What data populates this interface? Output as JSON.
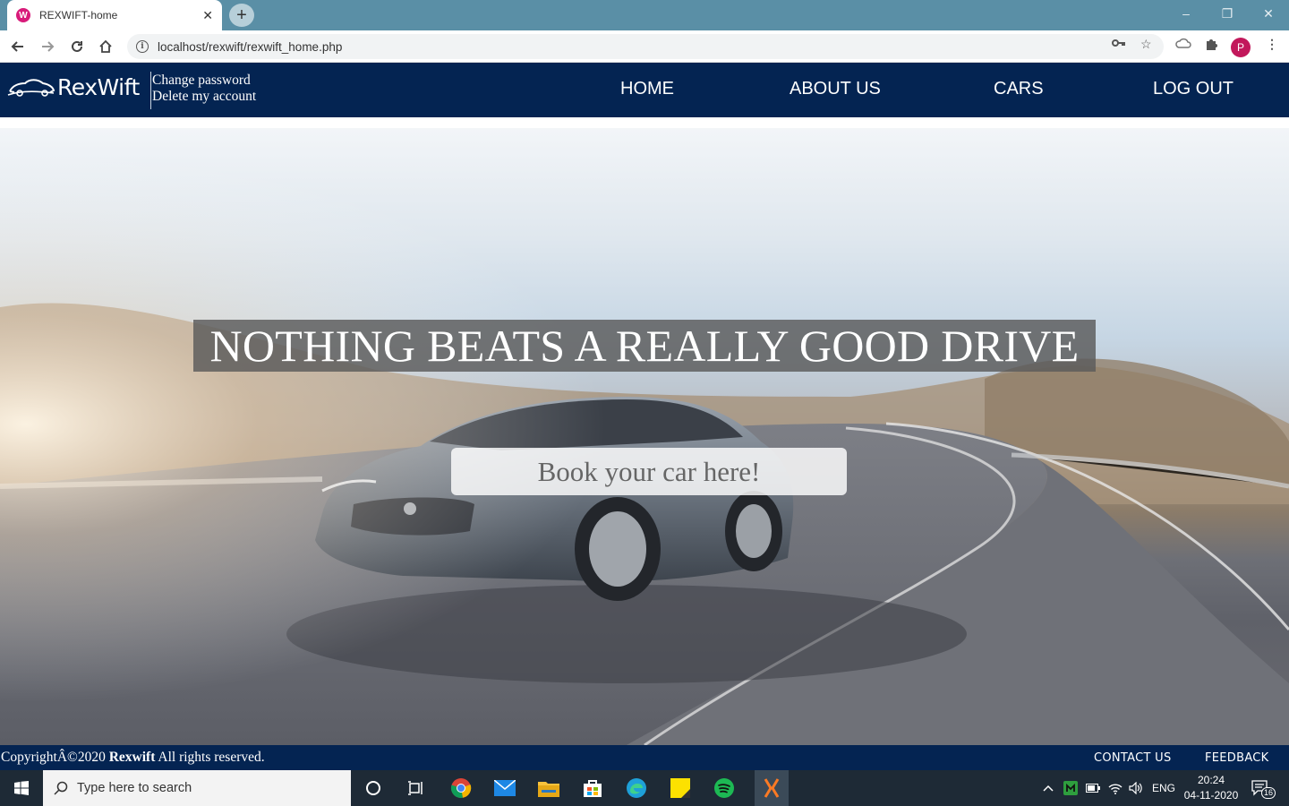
{
  "browser": {
    "tab_title": "REXWIFT-home",
    "tab_close": "✕",
    "new_tab": "+",
    "url": "localhost/rexwift/rexwift_home.php",
    "profile_initial": "P",
    "window_controls": [
      "–",
      "❐",
      "✕"
    ]
  },
  "site": {
    "brand": "RexWift",
    "account_links": [
      "Change password",
      "Delete my account"
    ],
    "nav": [
      "HOME",
      "ABOUT US",
      "CARS",
      "LOG OUT"
    ],
    "hero_headline": "NOTHING BEATS A REALLY GOOD DRIVE",
    "hero_button": "Book your car here!",
    "footer": {
      "copyright_prefix": "CopyrightÂ©2020 ",
      "copyright_brand": "Rexwift",
      "copyright_suffix": " All rights reserved.",
      "links": [
        "CONTACT US",
        "FEEDBACK"
      ]
    }
  },
  "taskbar": {
    "search_placeholder": "Type here to search",
    "language": "ENG",
    "time": "20:24",
    "date": "04-11-2020",
    "notification_count": "16"
  },
  "colors": {
    "site_navy": "#042452",
    "chrome_tab_strip": "#5a8fa6",
    "taskbar": "#1e2a36"
  }
}
